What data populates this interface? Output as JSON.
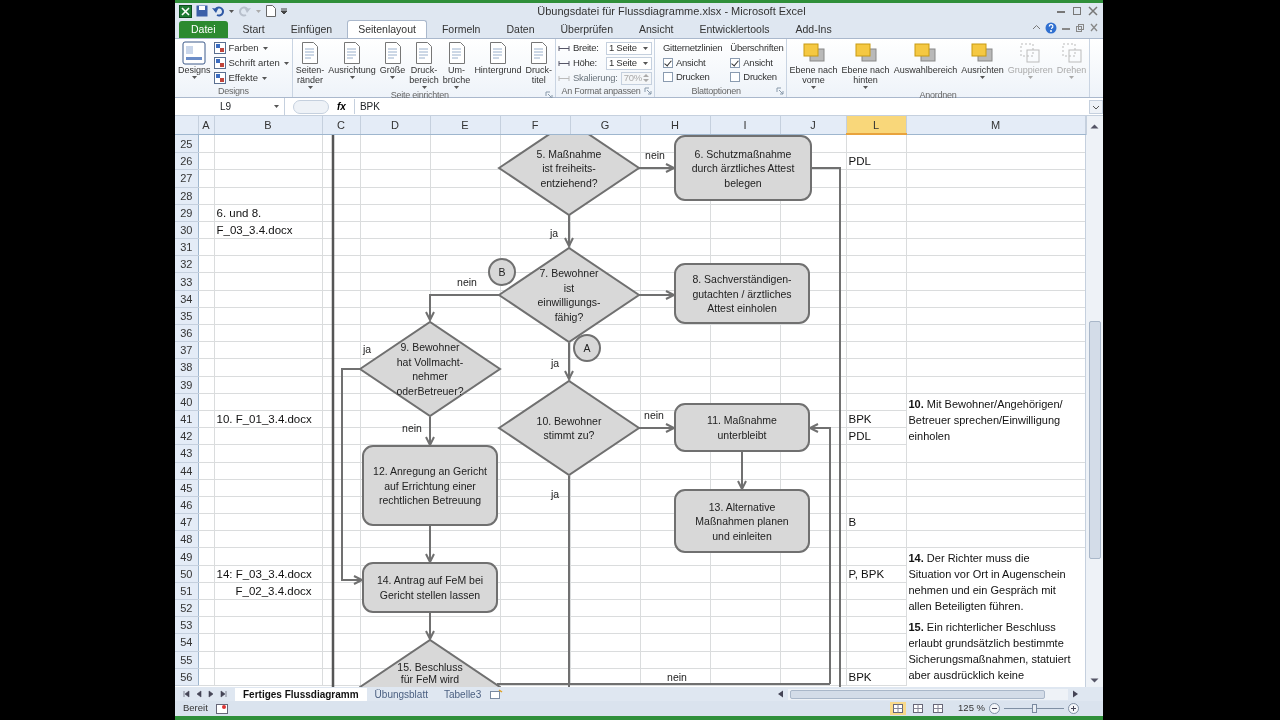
{
  "window": {
    "title": "Übungsdatei für Flussdiagramme.xlsx - Microsoft Excel"
  },
  "ribbon_tabs": [
    {
      "label": "Datei",
      "kind": "file",
      "selected": false
    },
    {
      "label": "Start",
      "kind": "tab",
      "selected": false
    },
    {
      "label": "Einfügen",
      "kind": "tab",
      "selected": false
    },
    {
      "label": "Seitenlayout",
      "kind": "tab",
      "selected": true
    },
    {
      "label": "Formeln",
      "kind": "tab",
      "selected": false
    },
    {
      "label": "Daten",
      "kind": "tab",
      "selected": false
    },
    {
      "label": "Überprüfen",
      "kind": "tab",
      "selected": false
    },
    {
      "label": "Ansicht",
      "kind": "tab",
      "selected": false
    },
    {
      "label": "Entwicklertools",
      "kind": "tab",
      "selected": false
    },
    {
      "label": "Add-Ins",
      "kind": "tab",
      "selected": false
    }
  ],
  "ribbon_groups": [
    {
      "label": "Designs",
      "launcher": false,
      "columns": [
        [
          {
            "kind": "large",
            "lines": [
              "Designs"
            ],
            "dropdown": true,
            "disabled": false
          }
        ],
        [
          {
            "kind": "small",
            "label": "Farben",
            "dropdown": true
          },
          {
            "kind": "small",
            "label": "Schrift arten",
            "dropdown": true
          },
          {
            "kind": "small",
            "label": "Effekte",
            "dropdown": true
          }
        ]
      ]
    },
    {
      "label": "Seite einrichten",
      "launcher": true,
      "columns": [
        [
          {
            "kind": "large",
            "lines": [
              "Seiten-",
              "ränder"
            ],
            "dropdown": true,
            "disabled": false
          }
        ],
        [
          {
            "kind": "large",
            "lines": [
              "Ausrichtung"
            ],
            "dropdown": true,
            "disabled": false
          }
        ],
        [
          {
            "kind": "large",
            "lines": [
              "Größe"
            ],
            "dropdown": true,
            "disabled": false
          }
        ],
        [
          {
            "kind": "large",
            "lines": [
              "Druck-",
              "bereich"
            ],
            "dropdown": true,
            "disabled": false
          }
        ],
        [
          {
            "kind": "large",
            "lines": [
              "Um-",
              "brüche"
            ],
            "dropdown": true,
            "disabled": false
          }
        ],
        [
          {
            "kind": "large",
            "lines": [
              "Hintergrund"
            ],
            "dropdown": false,
            "disabled": false
          }
        ],
        [
          {
            "kind": "large",
            "lines": [
              "Druck-",
              "titel"
            ],
            "dropdown": false,
            "disabled": false
          }
        ]
      ]
    },
    {
      "label": "An Format anpassen",
      "launcher": true,
      "columns": [
        [
          {
            "kind": "field",
            "label": "Breite:",
            "value": "1 Seite",
            "disabled": false
          },
          {
            "kind": "field",
            "label": "Höhe:",
            "value": "1 Seite",
            "disabled": false
          },
          {
            "kind": "spinner",
            "label": "Skalierung:",
            "value": "70%",
            "disabled": true
          }
        ]
      ]
    },
    {
      "label": "Blattoptionen",
      "launcher": true,
      "columns": [
        [
          {
            "kind": "heading",
            "label": "Gitternetzlinien"
          },
          {
            "kind": "check",
            "label": "Ansicht",
            "checked": true
          },
          {
            "kind": "check",
            "label": "Drucken",
            "checked": false
          }
        ],
        [
          {
            "kind": "heading",
            "label": "Überschriften"
          },
          {
            "kind": "check",
            "label": "Ansicht",
            "checked": true
          },
          {
            "kind": "check",
            "label": "Drucken",
            "checked": false
          }
        ]
      ]
    },
    {
      "label": "Anordnen",
      "launcher": false,
      "columns": [
        [
          {
            "kind": "large",
            "lines": [
              "Ebene nach",
              "vorne"
            ],
            "dropdown": true,
            "disabled": false
          }
        ],
        [
          {
            "kind": "large",
            "lines": [
              "Ebene nach",
              "hinten"
            ],
            "dropdown": true,
            "disabled": false
          }
        ],
        [
          {
            "kind": "large",
            "lines": [
              "Auswahlbereich"
            ],
            "dropdown": false,
            "disabled": false
          }
        ],
        [
          {
            "kind": "large",
            "lines": [
              "Ausrichten"
            ],
            "dropdown": true,
            "disabled": false
          }
        ],
        [
          {
            "kind": "large",
            "lines": [
              "Gruppieren"
            ],
            "dropdown": true,
            "disabled": true
          }
        ],
        [
          {
            "kind": "large",
            "lines": [
              "Drehen"
            ],
            "dropdown": true,
            "disabled": true
          }
        ]
      ]
    }
  ],
  "formula_bar": {
    "name_box": "L9",
    "function_label": "fx",
    "value": "BPK"
  },
  "sheet": {
    "columns": [
      {
        "label": "A",
        "selected": false
      },
      {
        "label": "B",
        "selected": false
      },
      {
        "label": "C",
        "selected": false
      },
      {
        "label": "D",
        "selected": false
      },
      {
        "label": "E",
        "selected": false
      },
      {
        "label": "F",
        "selected": false
      },
      {
        "label": "G",
        "selected": false
      },
      {
        "label": "H",
        "selected": false
      },
      {
        "label": "I",
        "selected": false
      },
      {
        "label": "J",
        "selected": false
      },
      {
        "label": "L",
        "selected": true
      },
      {
        "label": "M",
        "selected": false
      }
    ],
    "rows": [
      {
        "label": "25"
      },
      {
        "label": "26",
        "column_l": "PDL"
      },
      {
        "label": "27"
      },
      {
        "label": "28"
      },
      {
        "label": "29",
        "column_b": "6. und 8."
      },
      {
        "label": "30",
        "column_b": "F_03_3.4.docx"
      },
      {
        "label": "31"
      },
      {
        "label": "32"
      },
      {
        "label": "33"
      },
      {
        "label": "34"
      },
      {
        "label": "35"
      },
      {
        "label": "36"
      },
      {
        "label": "37"
      },
      {
        "label": "38"
      },
      {
        "label": "39"
      },
      {
        "label": "40",
        "column_m": [
          "**10.** Mit Bewohner/Angehörigen/",
          "Betreuer sprechen/Einwilligung",
          "einholen"
        ]
      },
      {
        "label": "41",
        "column_b": "10. F_01_3.4.docx",
        "column_l": "BPK",
        "column_m_merged": true
      },
      {
        "label": "42",
        "column_l": "PDL",
        "column_m_merged": true
      },
      {
        "label": "43"
      },
      {
        "label": "44"
      },
      {
        "label": "45"
      },
      {
        "label": "46"
      },
      {
        "label": "47",
        "column_l": "B"
      },
      {
        "label": "48"
      },
      {
        "label": "49",
        "column_m": [
          "**14.** Der Richter muss die",
          "Situation vor Ort in Augenschein",
          "nehmen und ein Gespräch mit",
          "allen Beteiligten führen."
        ]
      },
      {
        "label": "50",
        "column_b": "14: F_03_3.4.docx",
        "column_l": "P, BPK",
        "column_m_merged": true
      },
      {
        "label": "51",
        "column_b": "F_02_3.4.docx",
        "indented": true,
        "column_m_merged": true
      },
      {
        "label": "52",
        "column_m_merged": true
      },
      {
        "label": "53",
        "column_m": [
          "**15.** Ein richterlicher Beschluss",
          "erlaubt grundsätzlich bestimmte",
          "Sicherungsmaßnahmen, statuiert",
          "aber ausdrücklich keine"
        ]
      },
      {
        "label": "54",
        "column_m_merged": true
      },
      {
        "label": "55",
        "column_m_merged": true
      },
      {
        "label": "56",
        "column_l": "BPK",
        "column_m_merged": true
      }
    ]
  },
  "flowchart": {
    "nodes": [
      {
        "kind": "decision",
        "lines": [
          "5. Maßnahme",
          "ist freiheits-",
          "entziehend?"
        ]
      },
      {
        "kind": "process",
        "lines": [
          "6. Schutzmaßnahme",
          "durch ärztliches Attest",
          "belegen"
        ]
      },
      {
        "kind": "decision",
        "lines": [
          "7. Bewohner",
          "ist",
          "einwilligungs-",
          "fähig?"
        ]
      },
      {
        "kind": "process",
        "lines": [
          "8. Sachverständigen-",
          "gutachten / ärztliches",
          "Attest einholen"
        ]
      },
      {
        "kind": "decision",
        "lines": [
          "9. Bewohner",
          "hat Vollmacht-",
          "nehmer",
          "oderBetreuer?"
        ]
      },
      {
        "kind": "decision",
        "lines": [
          "10. Bewohner",
          "stimmt zu?"
        ]
      },
      {
        "kind": "process",
        "lines": [
          "11. Maßnahme",
          "unterbleibt"
        ]
      },
      {
        "kind": "process",
        "lines": [
          "12. Anregung an Gericht",
          "auf Errichtung einer",
          "rechtlichen Betreuung"
        ]
      },
      {
        "kind": "process",
        "lines": [
          "13. Alternative",
          "Maßnahmen planen",
          "und einleiten"
        ]
      },
      {
        "kind": "process",
        "lines": [
          "14. Antrag auf FeM bei",
          "Gericht  stellen lassen"
        ]
      },
      {
        "kind": "decision",
        "lines": [
          "15. Beschluss",
          "für FeM wird"
        ]
      },
      {
        "kind": "connector",
        "lines": [
          "B"
        ]
      },
      {
        "kind": "connector",
        "lines": [
          "A"
        ]
      }
    ],
    "labels": [
      "nein",
      "ja",
      "nein",
      "ja",
      "ja",
      "nein",
      "nein",
      "ja",
      "nein"
    ]
  },
  "sheet_tabs": [
    {
      "label": "Fertiges Flussdiagramm",
      "selected": true
    },
    {
      "label": "Übungsblatt",
      "selected": false
    },
    {
      "label": "Tabelle3",
      "selected": false
    }
  ],
  "status_bar": {
    "mode": "Bereit",
    "zoom": "125 %",
    "zoom_slider": {
      "level": 0.5
    },
    "views": [
      {
        "selected": true
      },
      {
        "selected": false
      },
      {
        "selected": false
      }
    ]
  }
}
